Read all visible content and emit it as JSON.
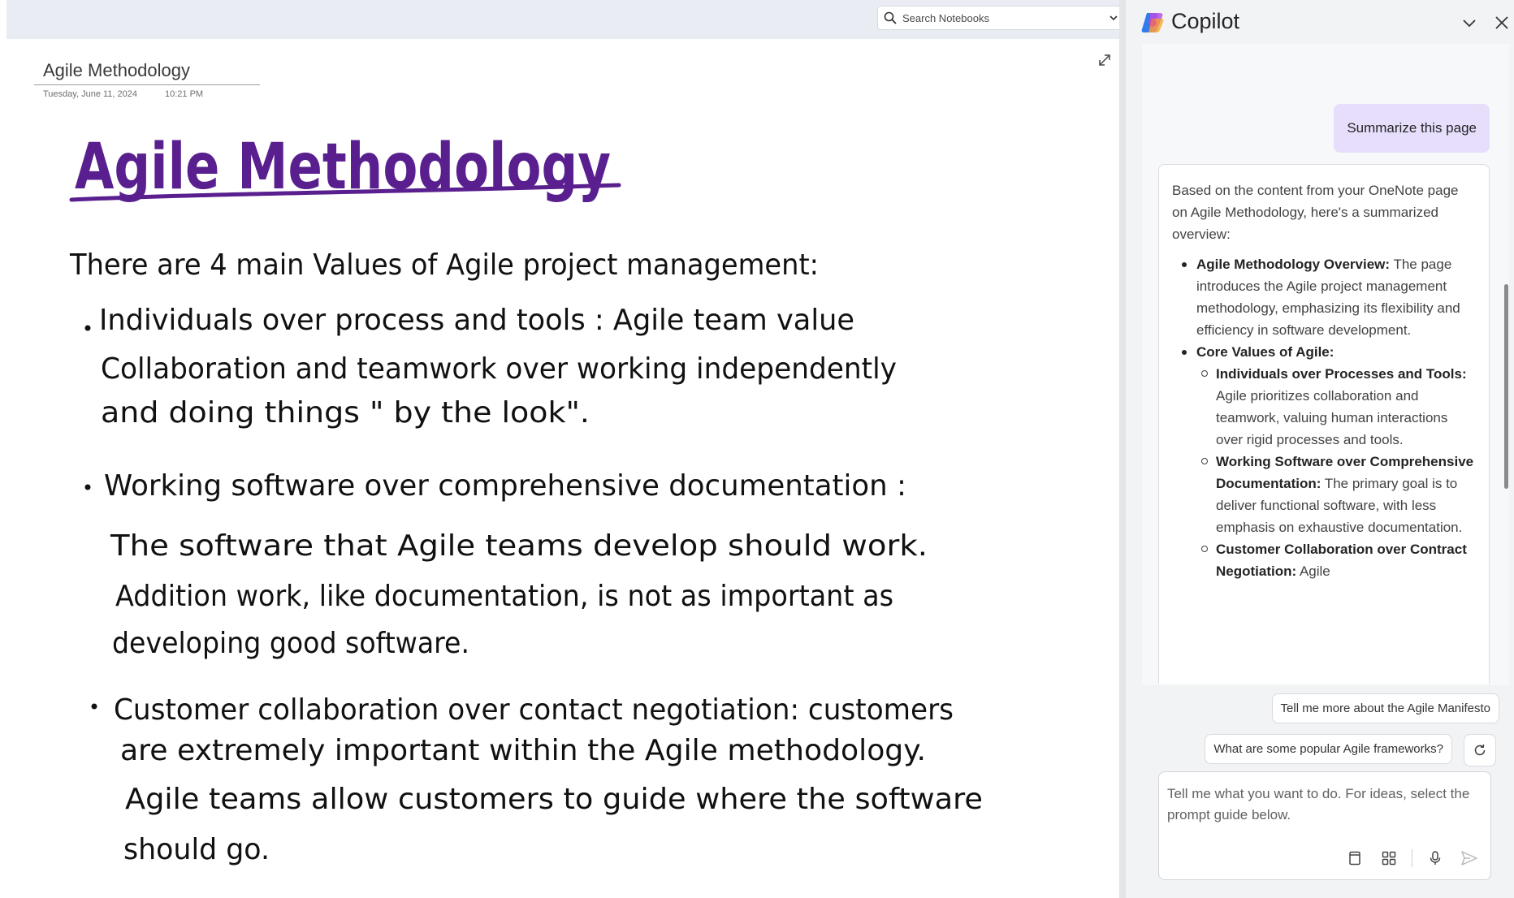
{
  "search": {
    "placeholder": "Search Notebooks"
  },
  "page": {
    "title": "Agile Methodology",
    "date": "Tuesday, June 11, 2024",
    "time": "10:21 PM"
  },
  "ink": {
    "heading": "Agile Methodology",
    "intro": "There are 4 main Values of Agile project management:",
    "bullets": [
      {
        "lines": [
          "Individuals over process and tools : Agile team value",
          "Collaboration and teamwork over working independently",
          "and doing things \" by the look\"."
        ]
      },
      {
        "lines": [
          "Working software over comprehensive documentation :",
          "The software that Agile teams develop should work.",
          "Addition work, like documentation, is not as important as",
          "developing good software."
        ]
      },
      {
        "lines": [
          "Customer collaboration over contact negotiation: customers",
          "are extremely important within the Agile methodology.",
          "Agile teams allow customers to guide where the software",
          "should go."
        ]
      }
    ]
  },
  "copilot": {
    "title": "Copilot",
    "user_prompt": "Summarize this page",
    "answer": {
      "intro": "Based on the content from your OneNote page on Agile Methodology, here's a summarized overview:",
      "overview_title": "Agile Methodology Overview:",
      "overview_text": " The page introduces the Agile project management methodology, emphasizing its flexibility and efficiency in software development.",
      "core_title": "Core Values of Agile:",
      "values": [
        {
          "title": "Individuals over Processes and Tools:",
          "text": " Agile prioritizes collaboration and teamwork, valuing human interactions over rigid processes and tools."
        },
        {
          "title": "Working Software over Comprehensive Documentation:",
          "text": " The primary goal is to deliver functional software, with less emphasis on exhaustive documentation."
        },
        {
          "title": "Customer Collaboration over Contract Negotiation:",
          "text": " Agile"
        }
      ]
    },
    "suggestions": [
      "Tell me more about the Agile Manifesto",
      "What are some popular Agile frameworks?"
    ],
    "compose_placeholder": "Tell me what you want to do. For ideas, select the prompt guide below."
  }
}
